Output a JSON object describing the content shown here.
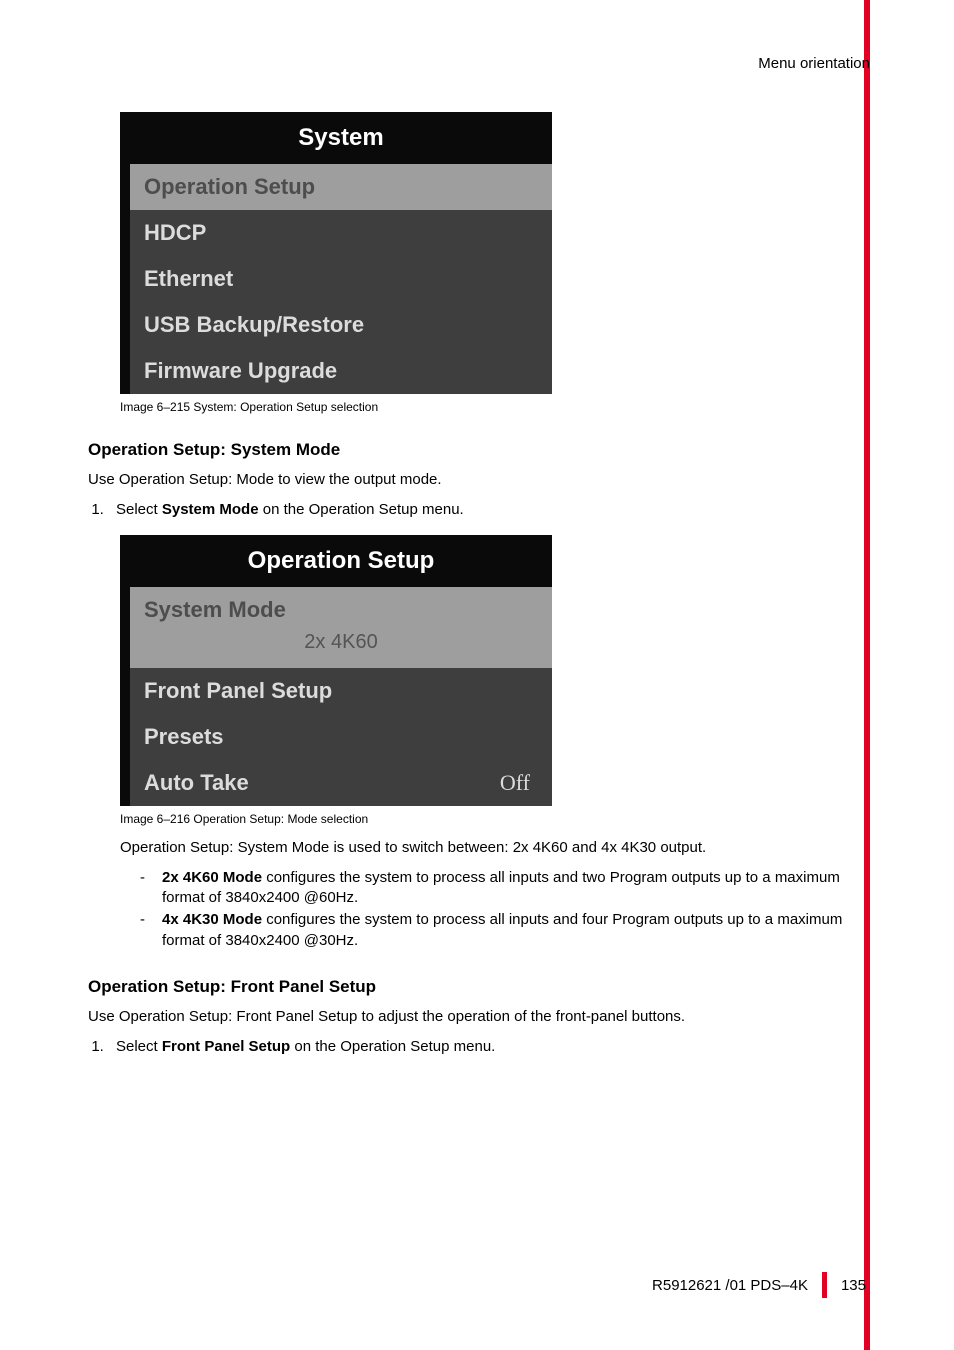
{
  "header": {
    "section": "Menu orientation"
  },
  "menu1": {
    "title": "System",
    "items": [
      "Operation Setup",
      "HDCP",
      "Ethernet",
      "USB Backup/Restore",
      "Firmware Upgrade"
    ]
  },
  "caption1": "Image 6–215  System: Operation Setup selection",
  "section1": {
    "heading": "Operation Setup: System Mode",
    "intro": "Use Operation Setup: Mode to view the output mode.",
    "step1_prefix": "Select ",
    "step1_bold": "System Mode",
    "step1_suffix": " on the Operation Setup menu."
  },
  "menu2": {
    "title": "Operation Setup",
    "system_mode_label": "System Mode",
    "system_mode_value": "2x 4K60",
    "front_panel": "Front Panel Setup",
    "presets": "Presets",
    "auto_take_label": "Auto Take",
    "auto_take_value": "Off"
  },
  "caption2": "Image 6–216  Operation Setup: Mode selection",
  "para1": "Operation Setup: System Mode is used to switch between: 2x 4K60 and 4x 4K30 output.",
  "bullets": {
    "b1_bold": "2x 4K60 Mode",
    "b1_text": " configures the system to process all inputs and two Program outputs up to a maximum format of 3840x2400 @60Hz.",
    "b2_bold": " 4x 4K30 Mode",
    "b2_text": " configures the system to process all inputs and four Program outputs up to a maximum format of 3840x2400 @30Hz."
  },
  "section2": {
    "heading": "Operation Setup: Front Panel Setup",
    "intro": "Use Operation Setup: Front Panel Setup to adjust the operation of the front-panel buttons.",
    "step1_prefix": "Select ",
    "step1_bold": "Front Panel Setup",
    "step1_suffix": " on the Operation Setup menu."
  },
  "footer": {
    "doc": "R5912621 /01 PDS–4K",
    "page": "135"
  }
}
